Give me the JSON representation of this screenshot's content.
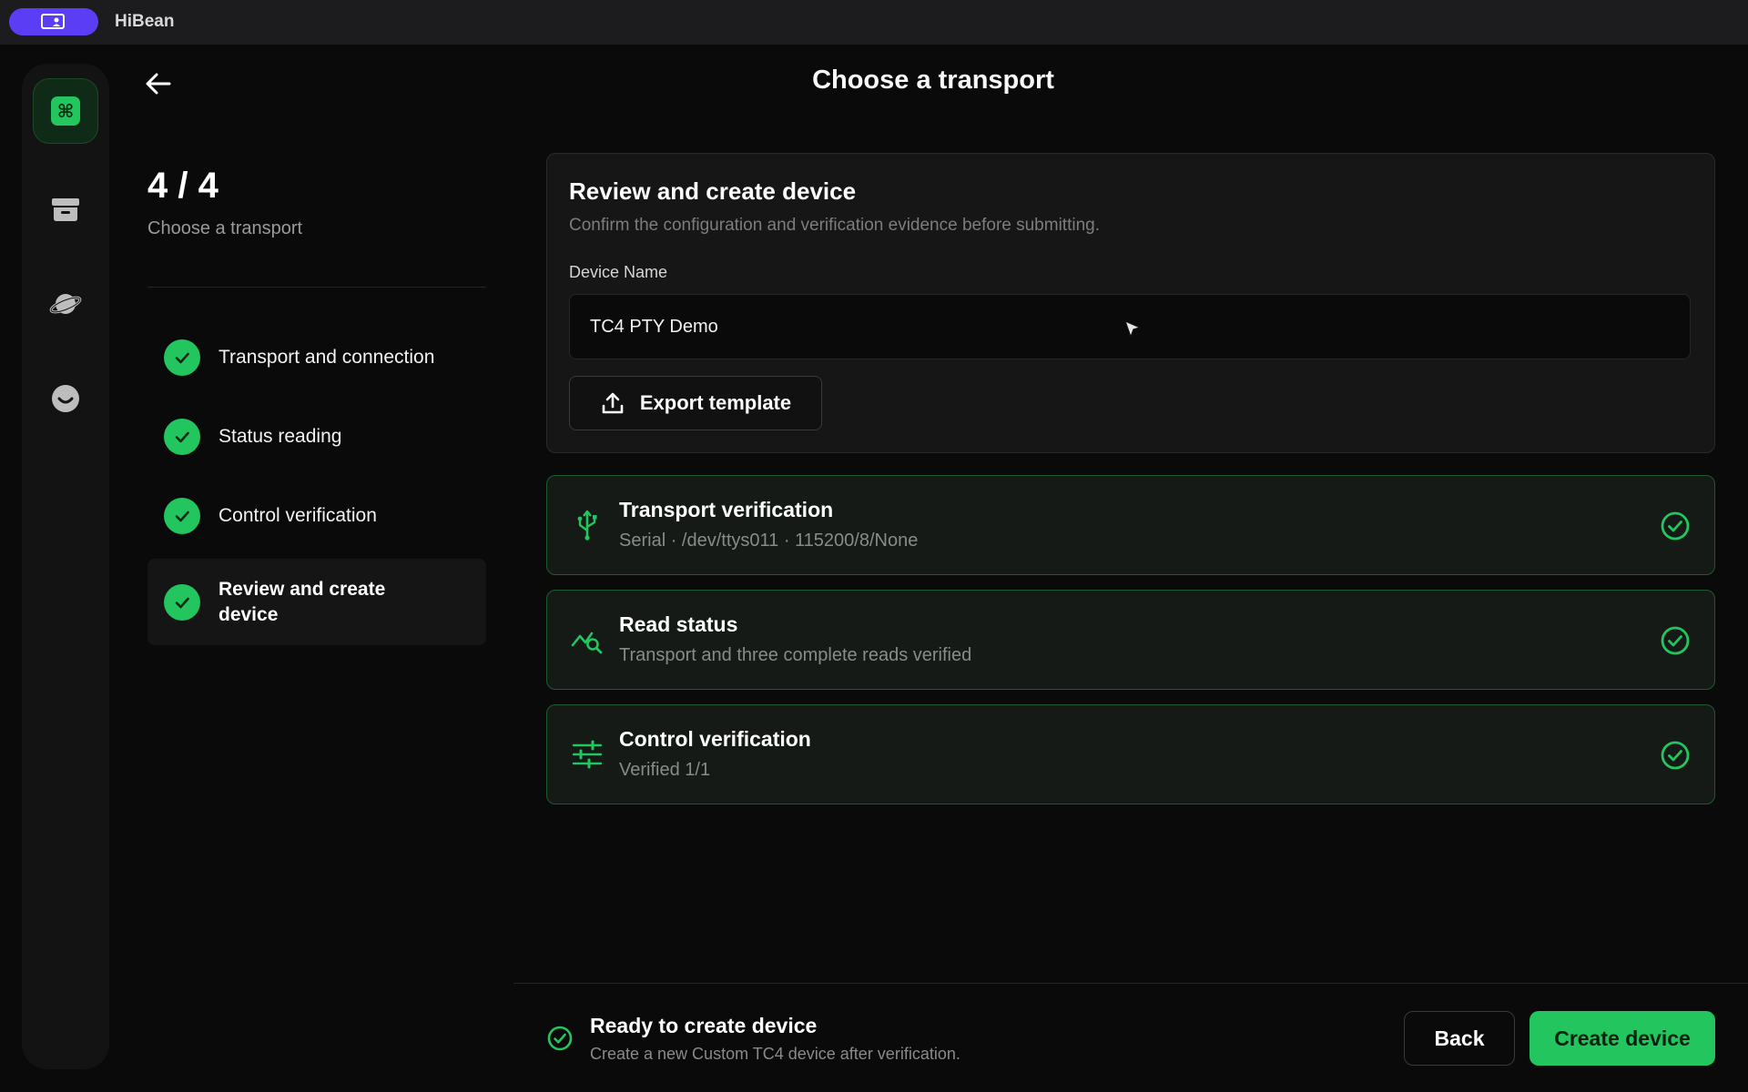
{
  "app": {
    "title": "HiBean",
    "badge_icon": "user-card-icon",
    "accent_color": "#22c55e",
    "brand_color": "#5b3df5"
  },
  "sidebar": {
    "items": [
      {
        "icon": "command-icon",
        "active": true
      },
      {
        "icon": "archive-box-icon",
        "active": false
      },
      {
        "icon": "planet-icon",
        "active": false
      },
      {
        "icon": "smiley-icon",
        "active": false
      }
    ]
  },
  "header": {
    "title": "Choose a transport",
    "back_icon": "arrow-left-icon"
  },
  "steps": {
    "count": "4 / 4",
    "subtitle": "Choose a transport",
    "items": [
      {
        "label": "Transport and connection",
        "done": true
      },
      {
        "label": "Status reading",
        "done": true
      },
      {
        "label": "Control verification",
        "done": true
      },
      {
        "label": "Review and create device",
        "done": true,
        "current": true
      }
    ]
  },
  "review": {
    "title": "Review and create device",
    "description": "Confirm the configuration and verification evidence before submitting.",
    "device_name_label": "Device Name",
    "device_name_value": "TC4 PTY Demo",
    "export_label": "Export template",
    "export_icon": "upload-icon"
  },
  "verifications": [
    {
      "icon": "usb-icon",
      "title": "Transport verification",
      "subtitle": "Serial · /dev/ttys011 · 115200/8/None",
      "status": "verified"
    },
    {
      "icon": "chart-search-icon",
      "title": "Read status",
      "subtitle": "Transport and three complete reads verified",
      "status": "verified"
    },
    {
      "icon": "sliders-icon",
      "title": "Control verification",
      "subtitle": "Verified 1/1",
      "status": "verified"
    }
  ],
  "footer": {
    "title": "Ready to create device",
    "subtitle": "Create a new Custom TC4 device after verification.",
    "back_label": "Back",
    "create_label": "Create device"
  }
}
